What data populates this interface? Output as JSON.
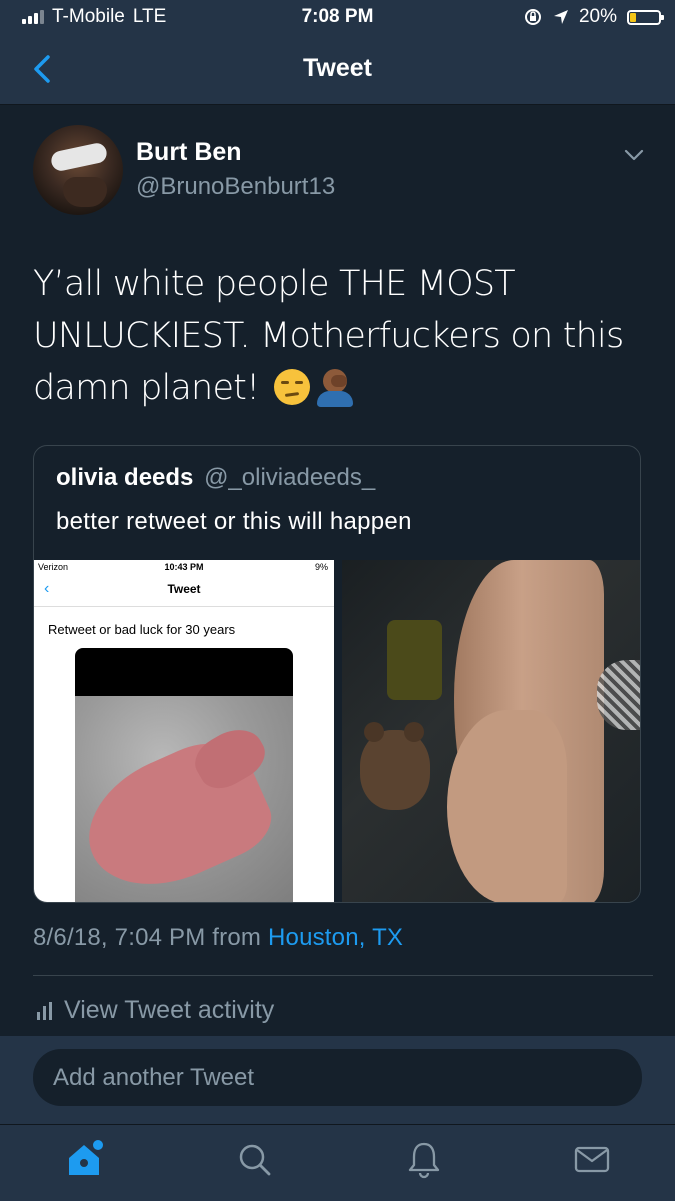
{
  "status_bar": {
    "carrier": "T-Mobile",
    "network": "LTE",
    "time": "7:08 PM",
    "battery_percent": "20%",
    "battery_level": 0.2,
    "battery_color": "#f5c518"
  },
  "nav": {
    "title": "Tweet",
    "back_icon": "chevron-left-icon"
  },
  "tweet": {
    "author_name": "Burt Ben",
    "author_handle": "@BrunoBenburt13",
    "text": "Y’all white people THE MOST UNLUCKIEST. Motherfuckers on this damn planet!",
    "emojis": [
      "unamused-face",
      "person-facepalming"
    ],
    "timestamp": "8/6/18, 7:04 PM from",
    "location": "Houston, TX"
  },
  "quote": {
    "name": "olivia deeds",
    "handle": "@_oliviadeeds_",
    "text": "better retweet or this will happen",
    "media_screenshot": {
      "carrier": "Verizon",
      "time": "10:43 PM",
      "battery": "9%",
      "title": "Tweet",
      "text": "Retweet or bad luck for 30 years"
    }
  },
  "activity": {
    "label": "View Tweet activity"
  },
  "reply": {
    "placeholder": "Add another Tweet"
  },
  "tabs": [
    "home-icon",
    "search-icon",
    "notifications-icon",
    "messages-icon"
  ],
  "colors": {
    "background": "#15202b",
    "bar": "#243447",
    "accent": "#1d9bf0",
    "muted": "#8899a6"
  }
}
